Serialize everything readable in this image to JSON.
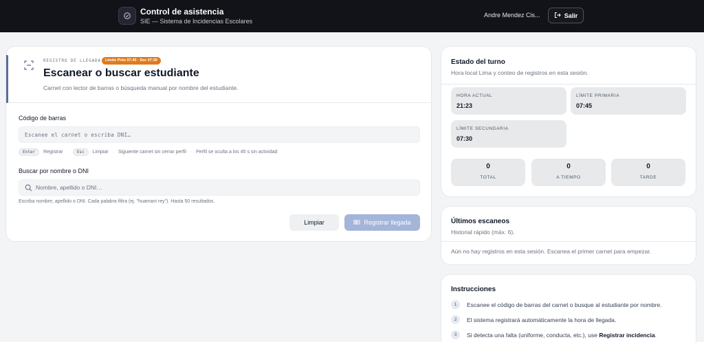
{
  "header": {
    "title": "Control de asistencia",
    "subtitle": "SIE — Sistema de Incidencias Escolares",
    "user_name": "Andre Mendez Cis...",
    "logout_label": "Salir"
  },
  "scan": {
    "kicker": "REGISTRO DE LLEGADA",
    "limit_badge": "Límite Prim 07:45 · Sec 07:30",
    "title": "Escanear o buscar estudiante",
    "subtitle": "Carnet con lector de barras o búsqueda manual por nombre del estudiante.",
    "barcode_label": "Código de barras",
    "barcode_placeholder": "Escanee el carnet o escriba DNI…",
    "hints": {
      "enter_key": "Enter",
      "enter_text": "Registrar",
      "esc_key": "Esc",
      "esc_text": "Limpiar",
      "next_text": "Siguiente carnet sin cerrar perfil",
      "hide_text": "Perfil se oculta a los 45 s sin actividad"
    },
    "search_label": "Buscar por nombre o DNI",
    "search_placeholder": "Nombre, apellido o DNI…",
    "search_help": "Escriba nombre, apellido o DNI. Cada palabra filtra (ej. \"huamani rey\"). Hasta 50 resultados.",
    "clear_button": "Limpiar",
    "register_button": "Registrar llegada"
  },
  "turno": {
    "title": "Estado del turno",
    "subtitle": "Hora local Lima y conteo de registros en esta sesión.",
    "hora_actual_label": "HORA ACTUAL",
    "hora_actual": "21:23",
    "limite_primaria_label": "LÍMITE PRIMARIA",
    "limite_primaria": "07:45",
    "limite_secundaria_label": "LÍMITE SECUNDARIA",
    "limite_secundaria": "07:30",
    "stats": {
      "total_value": "0",
      "total_label": "TOTAL",
      "a_tiempo_value": "0",
      "a_tiempo_label": "A TIEMPO",
      "tarde_value": "0",
      "tarde_label": "TARDE"
    }
  },
  "recent": {
    "title": "Últimos escaneos",
    "subtitle": "Historial rápido (máx. 6).",
    "empty": "Aún no hay registros en esta sesión. Escanea el primer carnet para empezar."
  },
  "instructions": {
    "title": "Instrucciones",
    "steps": [
      {
        "num": "1",
        "text": "Escanee el código de barras del carnet o busque al estudiante por nombre."
      },
      {
        "num": "2",
        "text": "El sistema registrará automáticamente la hora de llegada."
      },
      {
        "num": "3",
        "text": "Si detecta una falta (uniforme, conducta, etc.), use ",
        "bold": "Registrar incidencia",
        "end": "."
      }
    ]
  },
  "colors": {
    "topbar": "#111318",
    "badge": "#e07a1f",
    "register_button": "#a3b5d9",
    "accent": "#5b6b9a"
  },
  "icons": [
    "shield-icon",
    "logout-icon",
    "scan-icon",
    "search-icon",
    "barcode-icon"
  ]
}
